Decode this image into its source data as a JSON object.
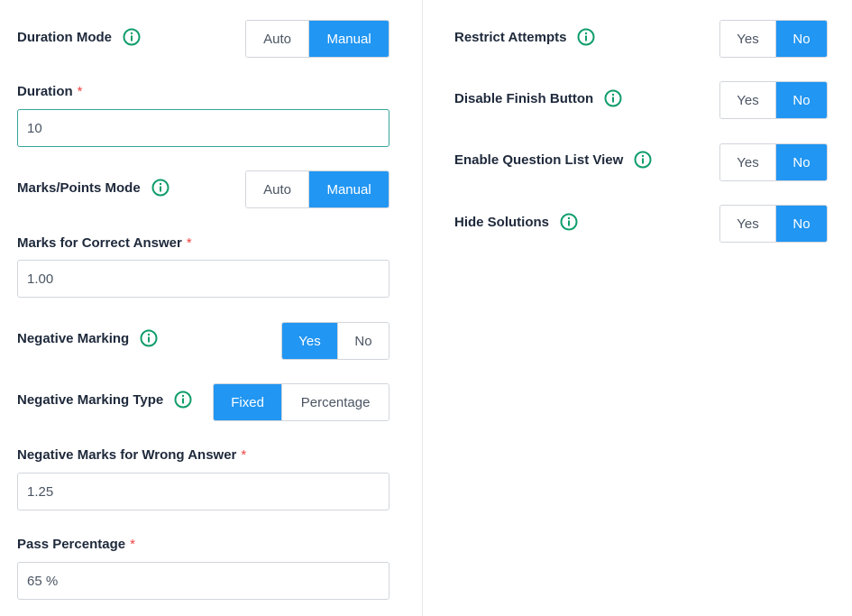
{
  "left": {
    "duration_mode": {
      "label": "Duration Mode",
      "options": [
        "Auto",
        "Manual"
      ],
      "selected": "Manual"
    },
    "duration": {
      "label": "Duration",
      "required_mark": "*",
      "value": "10"
    },
    "marks_mode": {
      "label": "Marks/Points Mode",
      "options": [
        "Auto",
        "Manual"
      ],
      "selected": "Manual"
    },
    "marks_correct": {
      "label": "Marks for Correct Answer",
      "required_mark": "*",
      "value": "1.00"
    },
    "negative_marking": {
      "label": "Negative Marking",
      "options": [
        "Yes",
        "No"
      ],
      "selected": "Yes"
    },
    "negative_marking_type": {
      "label": "Negative Marking Type",
      "options": [
        "Fixed",
        "Percentage"
      ],
      "selected": "Fixed"
    },
    "negative_marks_wrong": {
      "label": "Negative Marks for Wrong Answer",
      "required_mark": "*",
      "value": "1.25"
    },
    "pass_percentage": {
      "label": "Pass Percentage",
      "required_mark": "*",
      "value": "65 %"
    }
  },
  "right": {
    "restrict_attempts": {
      "label": "Restrict Attempts",
      "options": [
        "Yes",
        "No"
      ],
      "selected": "No"
    },
    "disable_finish": {
      "label": "Disable Finish Button",
      "options": [
        "Yes",
        "No"
      ],
      "selected": "No"
    },
    "question_list_view": {
      "label": "Enable Question List View",
      "options": [
        "Yes",
        "No"
      ],
      "selected": "No"
    },
    "hide_solutions": {
      "label": "Hide Solutions",
      "options": [
        "Yes",
        "No"
      ],
      "selected": "No"
    }
  },
  "colors": {
    "accent": "#2196f3",
    "info_icon": "#0f9d6b",
    "required": "#ef4444",
    "focus_border": "#38a49a"
  },
  "icons": {
    "info": "info-circle-icon"
  }
}
